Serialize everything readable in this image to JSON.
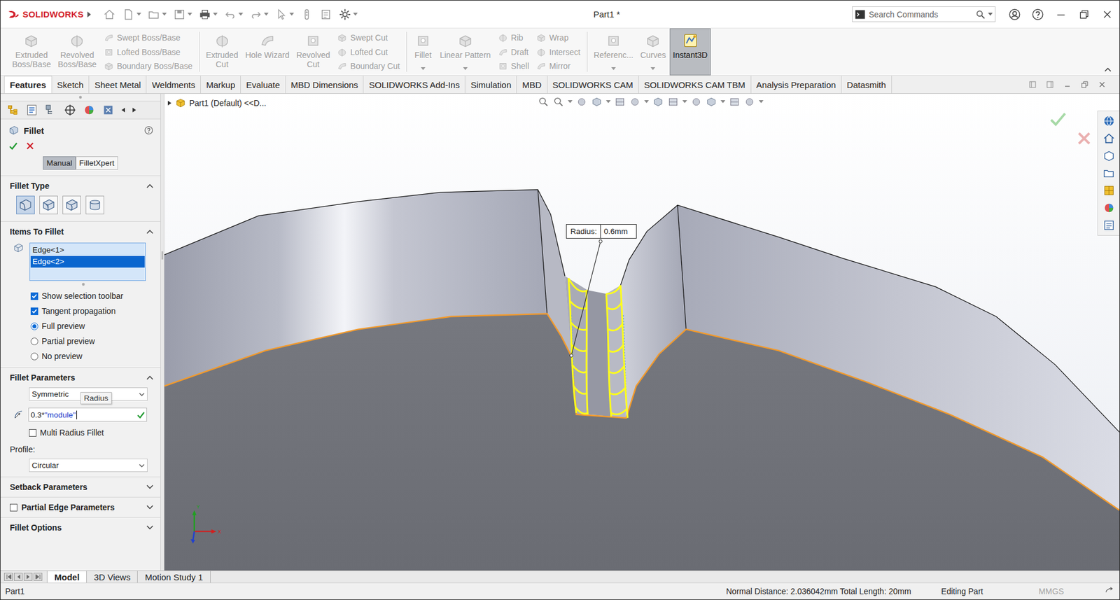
{
  "app": {
    "logo": "SOLIDWORKS"
  },
  "window": {
    "title": "Part1 *"
  },
  "search": {
    "placeholder": "Search Commands"
  },
  "ribbon": {
    "groups": [
      {
        "items": [
          {
            "kind": "large",
            "lines": [
              "Extruded",
              "Boss/Base"
            ],
            "disabled": true,
            "selected": false,
            "has_menu": false
          },
          {
            "kind": "large",
            "lines": [
              "Revolved",
              "Boss/Base"
            ],
            "disabled": true,
            "selected": false,
            "has_menu": false
          },
          {
            "kind": "column",
            "items": [
              {
                "label": "Swept Boss/Base",
                "disabled": true
              },
              {
                "label": "Lofted Boss/Base",
                "disabled": true
              },
              {
                "label": "Boundary Boss/Base",
                "disabled": true
              }
            ]
          }
        ]
      },
      {
        "items": [
          {
            "kind": "large",
            "lines": [
              "Extruded",
              "Cut"
            ],
            "disabled": true,
            "selected": false,
            "has_menu": false
          },
          {
            "kind": "large",
            "lines": [
              "Hole Wizard"
            ],
            "disabled": true,
            "selected": false,
            "has_menu": false
          },
          {
            "kind": "large",
            "lines": [
              "Revolved",
              "Cut"
            ],
            "disabled": true,
            "selected": false,
            "has_menu": false
          },
          {
            "kind": "column",
            "items": [
              {
                "label": "Swept Cut",
                "disabled": true
              },
              {
                "label": "Lofted Cut",
                "disabled": true
              },
              {
                "label": "Boundary Cut",
                "disabled": true
              }
            ]
          }
        ]
      },
      {
        "items": [
          {
            "kind": "large",
            "lines": [
              "Fillet"
            ],
            "disabled": true,
            "selected": false,
            "has_menu": true
          },
          {
            "kind": "large",
            "lines": [
              "Linear Pattern"
            ],
            "disabled": true,
            "selected": false,
            "has_menu": true
          },
          {
            "kind": "column",
            "items": [
              {
                "label": "Rib",
                "disabled": true
              },
              {
                "label": "Draft",
                "disabled": true
              },
              {
                "label": "Shell",
                "disabled": true
              }
            ]
          },
          {
            "kind": "column",
            "items": [
              {
                "label": "Wrap",
                "disabled": true
              },
              {
                "label": "Intersect",
                "disabled": true
              },
              {
                "label": "Mirror",
                "disabled": true
              }
            ]
          }
        ]
      },
      {
        "items": [
          {
            "kind": "large",
            "lines": [
              "Referenc..."
            ],
            "disabled": true,
            "selected": false,
            "has_menu": true
          },
          {
            "kind": "large",
            "lines": [
              "Curves"
            ],
            "disabled": true,
            "selected": false,
            "has_menu": true
          },
          {
            "kind": "large",
            "lines": [
              "Instant3D"
            ],
            "disabled": false,
            "selected": true,
            "has_menu": false
          }
        ]
      }
    ]
  },
  "tabs": [
    {
      "label": "Features",
      "selected": true
    },
    {
      "label": "Sketch",
      "selected": false
    },
    {
      "label": "Sheet Metal",
      "selected": false
    },
    {
      "label": "Weldments",
      "selected": false
    },
    {
      "label": "Markup",
      "selected": false
    },
    {
      "label": "Evaluate",
      "selected": false
    },
    {
      "label": "MBD Dimensions",
      "selected": false
    },
    {
      "label": "SOLIDWORKS Add-Ins",
      "selected": false
    },
    {
      "label": "Simulation",
      "selected": false
    },
    {
      "label": "MBD",
      "selected": false
    },
    {
      "label": "SOLIDWORKS CAM",
      "selected": false
    },
    {
      "label": "SOLIDWORKS CAM TBM",
      "selected": false
    },
    {
      "label": "Analysis Preparation",
      "selected": false
    },
    {
      "label": "Datasmith",
      "selected": false
    }
  ],
  "tree": {
    "breadcrumb": "Part1 (Default) <<D..."
  },
  "fillet": {
    "title": "Fillet",
    "modes": [
      {
        "label": "Manual",
        "selected": true
      },
      {
        "label": "FilletXpert",
        "selected": false
      }
    ],
    "fillet_type": {
      "title": "Fillet Type",
      "expanded": true,
      "types": [
        {
          "selected": true
        },
        {
          "selected": false
        },
        {
          "selected": false
        },
        {
          "selected": false
        }
      ]
    },
    "items_to_fillet": {
      "title": "Items To Fillet",
      "expanded": true,
      "items": [
        {
          "label": "Edge<1>",
          "selected": false
        },
        {
          "label": "Edge<2>",
          "selected": true
        }
      ],
      "checkboxes": [
        {
          "label": "Show selection toolbar",
          "checked": true
        },
        {
          "label": "Tangent propagation",
          "checked": true
        }
      ],
      "preview": [
        {
          "label": "Full preview",
          "selected": true
        },
        {
          "label": "Partial preview",
          "selected": false
        },
        {
          "label": "No preview",
          "selected": false
        }
      ]
    },
    "parameters": {
      "title": "Fillet Parameters",
      "expanded": true,
      "method": "Symmetric",
      "tooltip": "Radius",
      "radius_prefix": "0.3*",
      "radius_variable": "\"module\"",
      "multi_radius": {
        "label": "Multi Radius Fillet",
        "checked": false
      },
      "profile_label": "Profile:",
      "profile": "Circular"
    },
    "collapsed_sections": [
      {
        "kind": "plain",
        "title": "Setback Parameters",
        "expanded": false
      },
      {
        "kind": "checkbox",
        "title": "Partial Edge Parameters",
        "expanded": false,
        "checked": false
      },
      {
        "kind": "plain",
        "title": "Fillet Options",
        "expanded": false
      }
    ]
  },
  "viewport": {
    "callout_label": "Radius:",
    "callout_value": "0.6mm",
    "axes": [
      "Y",
      "X"
    ]
  },
  "bottom_tabs": [
    {
      "label": "Model",
      "selected": true
    },
    {
      "label": "3D Views",
      "selected": false
    },
    {
      "label": "Motion Study 1",
      "selected": false
    }
  ],
  "status_bar": {
    "document": "Part1",
    "measure": "Normal Distance: 2.036042mm Total Length: 20mm",
    "mode": "Editing Part",
    "units": "MMGS",
    "units_dimmed": true
  }
}
